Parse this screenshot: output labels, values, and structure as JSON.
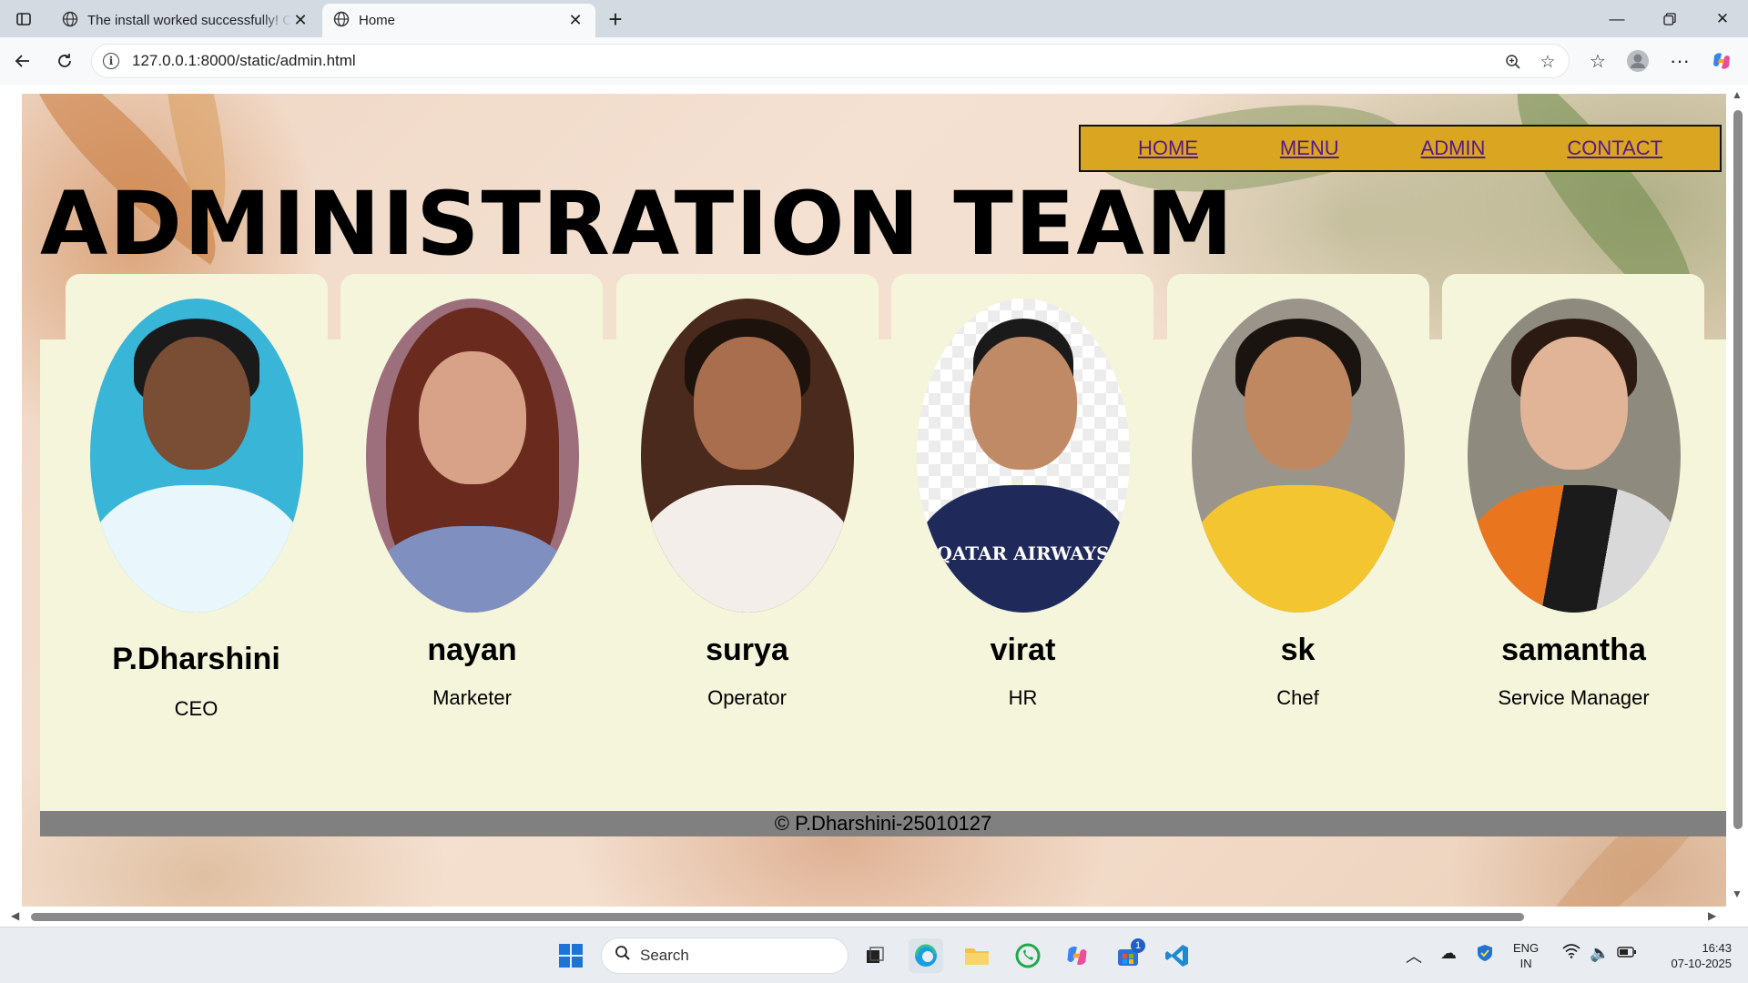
{
  "browser": {
    "tabs": [
      {
        "title": "The install worked successfully! Congratulations!",
        "active": false
      },
      {
        "title": "Home",
        "active": true
      }
    ],
    "url": "127.0.0.1:8000/static/admin.html"
  },
  "nav": {
    "items": [
      "HOME",
      "MENU",
      "ADMIN",
      "CONTACT"
    ]
  },
  "page": {
    "title": "ADMINISTRATION TEAM",
    "footer": "© P.Dharshini-25010127"
  },
  "team": [
    {
      "name": "P.Dharshini",
      "role": "CEO"
    },
    {
      "name": "nayan",
      "role": "Marketer"
    },
    {
      "name": "surya",
      "role": "Operator"
    },
    {
      "name": "virat",
      "role": "HR"
    },
    {
      "name": "sk",
      "role": "Chef"
    },
    {
      "name": "samantha",
      "role": "Service Manager"
    }
  ],
  "photo_jersey_text": "QATAR AIRWAYS",
  "taskbar": {
    "search_placeholder": "Search",
    "lang": "ENG",
    "region": "IN",
    "time": "16:43",
    "date": "07-10-2025",
    "store_badge": "1"
  },
  "colors": {
    "nav_bg": "#daa520",
    "panel_bg": "#f5f5dc",
    "footer_bg": "#808080",
    "link": "#551a8b"
  }
}
